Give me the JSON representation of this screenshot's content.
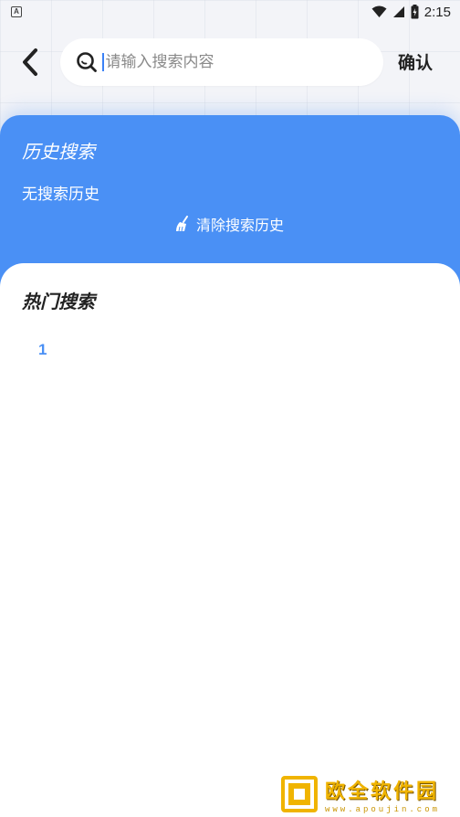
{
  "status_bar": {
    "notification_icon": "a-square-icon",
    "notification_glyph": "A",
    "time": "2:15",
    "icons": [
      "wifi-icon",
      "signal-icon",
      "battery-icon"
    ]
  },
  "header": {
    "search": {
      "placeholder": "请输入搜索内容",
      "value": ""
    },
    "confirm_label": "确认"
  },
  "history": {
    "title": "历史搜索",
    "empty_text": "无搜索历史",
    "clear_label": "清除搜索历史"
  },
  "hot": {
    "title": "热门搜索",
    "items": [
      "1"
    ]
  },
  "watermark": {
    "title": "欧全软件园",
    "subtitle": "www.apoujin.com"
  },
  "colors": {
    "accent": "#4a90f5",
    "watermark": "#f0b400"
  }
}
